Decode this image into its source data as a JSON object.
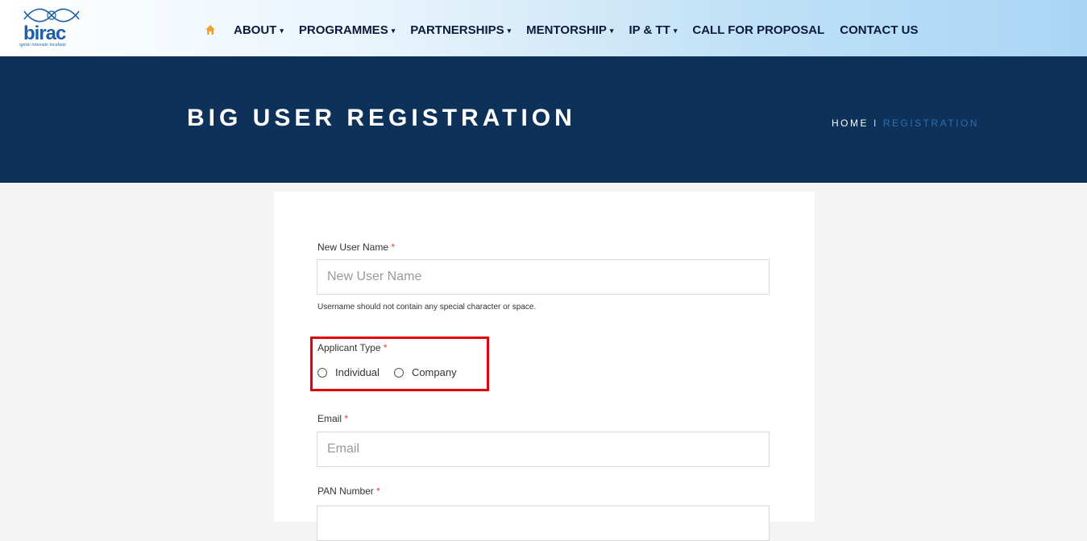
{
  "brand": {
    "logo_text": "birac",
    "tagline": "ignite innovate incubate"
  },
  "nav": {
    "items": [
      {
        "label": "ABOUT",
        "dropdown": true
      },
      {
        "label": "PROGRAMMES",
        "dropdown": true
      },
      {
        "label": "PARTNERSHIPS",
        "dropdown": true
      },
      {
        "label": "MENTORSHIP",
        "dropdown": true
      },
      {
        "label": "IP & TT",
        "dropdown": true
      },
      {
        "label": "CALL FOR PROPOSAL",
        "dropdown": false
      },
      {
        "label": "CONTACT US",
        "dropdown": false
      }
    ],
    "caret": "▾"
  },
  "banner": {
    "title": "BIG USER REGISTRATION",
    "breadcrumb_home": "HOME",
    "breadcrumb_sep": "I",
    "breadcrumb_current": "REGISTRATION"
  },
  "form": {
    "username_label": "New User Name",
    "username_placeholder": "New User Name",
    "username_help": "Username should not contain any special character or space.",
    "applicant_type_label": "Applicant Type",
    "applicant_options": [
      "Individual",
      "Company"
    ],
    "email_label": "Email",
    "email_placeholder": "Email",
    "pan_label": "PAN Number",
    "required_mark": "*"
  },
  "colors": {
    "banner_bg": "#0d3158",
    "highlight_border": "#e0000a",
    "required": "#e53935",
    "home_icon": "#f0a030"
  }
}
